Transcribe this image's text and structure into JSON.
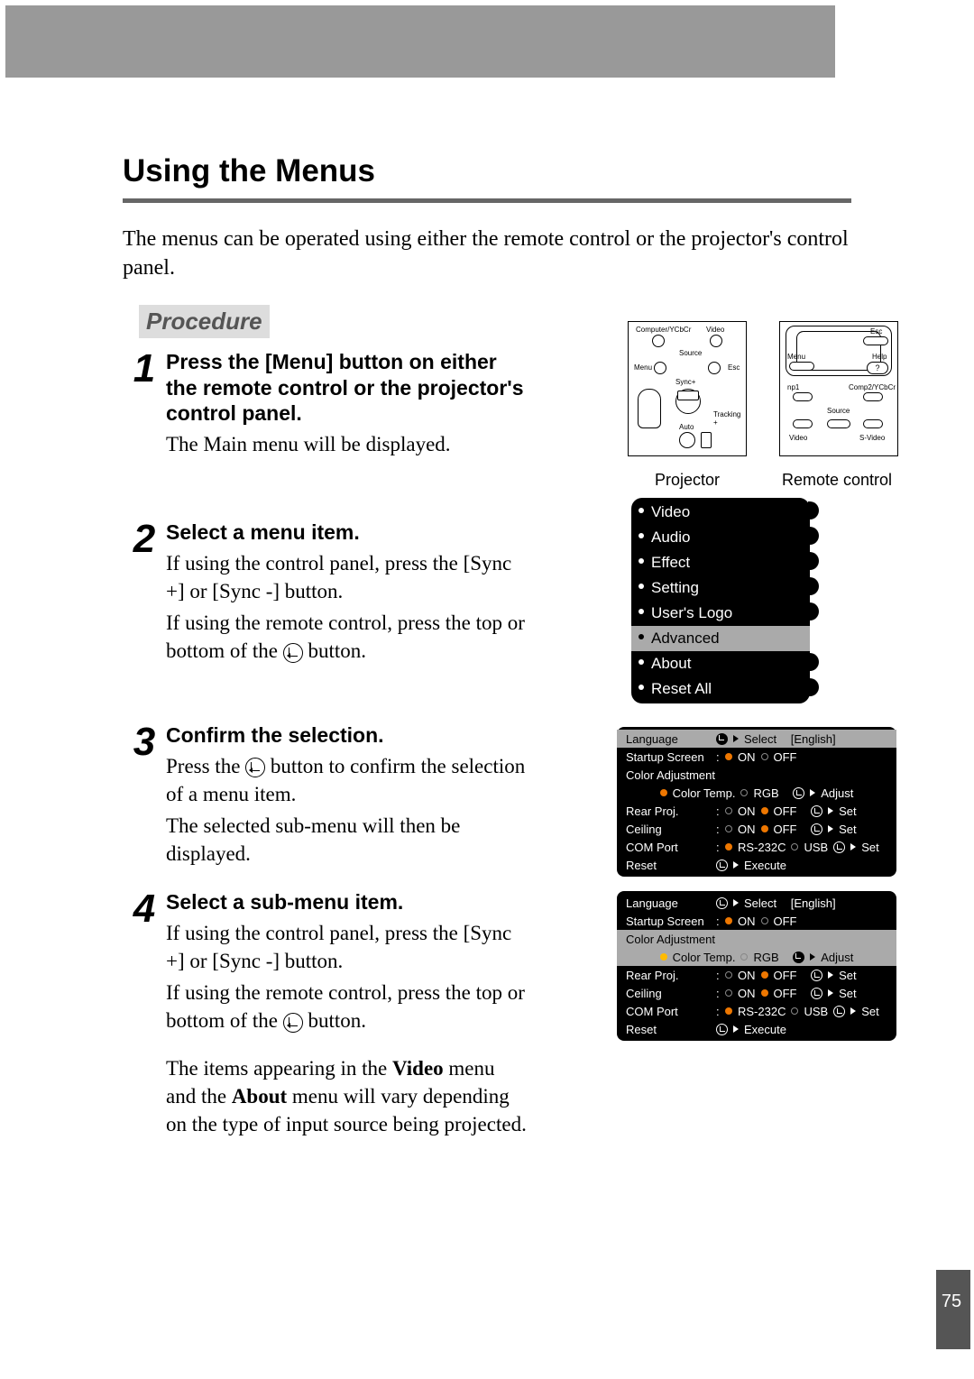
{
  "page_number": "75",
  "heading": "Using the Menus",
  "intro": "The menus can be operated using either the remote control or the projector's control panel.",
  "procedure_label": "Procedure",
  "steps": {
    "s1": {
      "num": "1",
      "title": "Press the [Menu] button on either the remote control or the projector's control panel.",
      "text": "The Main menu will be displayed."
    },
    "s2": {
      "num": "2",
      "title": "Select a menu item.",
      "text1": "If using the control panel, press the  [Sync +] or [Sync -] button.",
      "text2a": "If using the remote control, press the top or bottom of the ",
      "text2b": " button."
    },
    "s3": {
      "num": "3",
      "title": "Confirm the selection.",
      "text1a": "Press the ",
      "text1b": " button to confirm the selection of a menu item.",
      "text2": "The selected sub-menu will then be displayed."
    },
    "s4": {
      "num": "4",
      "title": "Select a sub-menu item.",
      "text1": "If using the control panel, press the  [Sync +] or [Sync -] button.",
      "text2a": "If using the remote control, press the top or bottom of the ",
      "text2b": " button.",
      "note_a": "The items appearing in the ",
      "note_b": "Video",
      "note_c": " menu and the ",
      "note_d": "About",
      "note_e": " menu will vary depending on the type of input source being projected."
    }
  },
  "fig": {
    "projector_label": "Projector",
    "remote_label": "Remote control",
    "proj": {
      "computer": "Computer/YCbCr",
      "video": "Video",
      "source": "Source",
      "menu": "Menu",
      "esc": "Esc",
      "syncp": "Sync+",
      "keystone": "",
      "tracking": "Tracking +",
      "auto": "Auto"
    },
    "remote": {
      "esc": "Esc",
      "menu": "Menu",
      "help": "Help",
      "q": "?",
      "np1": "np1",
      "comp2": "Comp2/YCbCr",
      "source": "Source",
      "video": "Video",
      "svideo": "S-Video"
    }
  },
  "mainmenu": [
    "Video",
    "Audio",
    "Effect",
    "Setting",
    "User's Logo",
    "Advanced",
    "About",
    "Reset All"
  ],
  "submenu": {
    "rows": {
      "language": {
        "label": "Language",
        "action": "Select",
        "value": "[English]"
      },
      "startup": {
        "label": "Startup Screen",
        "on": "ON",
        "off": "OFF"
      },
      "coloradj": {
        "label": "Color Adjustment"
      },
      "coloradj_line": {
        "ctemp": "Color Temp.",
        "rgb": "RGB",
        "action": "Adjust"
      },
      "rear": {
        "label": "Rear Proj.",
        "on": "ON",
        "off": "OFF",
        "action": "Set"
      },
      "ceiling": {
        "label": "Ceiling",
        "on": "ON",
        "off": "OFF",
        "action": "Set"
      },
      "com": {
        "label": "COM Port",
        "rs": "RS-232C",
        "usb": "USB",
        "action": "Set"
      },
      "reset": {
        "label": "Reset",
        "action": "Execute"
      }
    }
  }
}
